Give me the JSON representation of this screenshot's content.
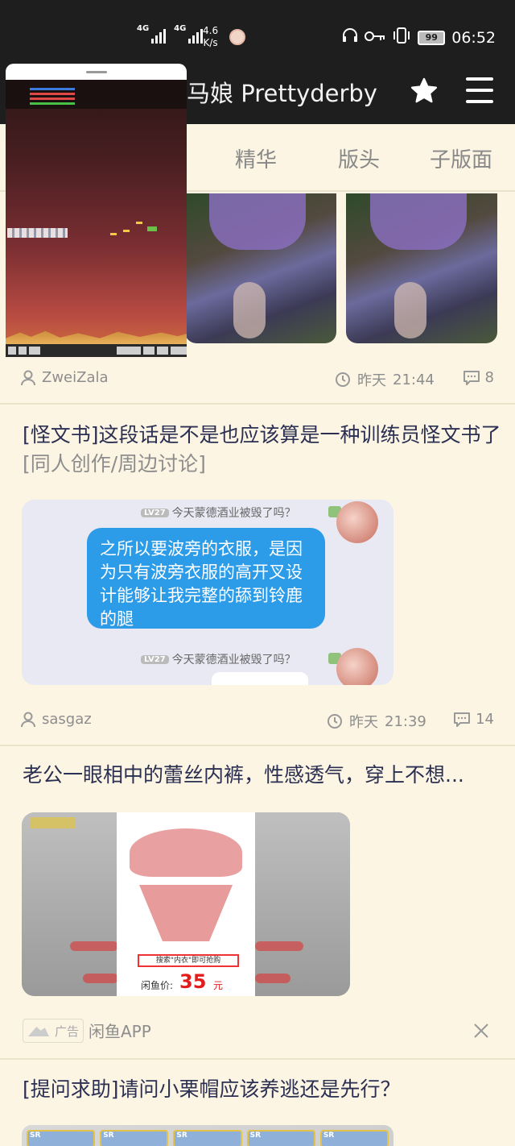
{
  "status_bar": {
    "network_1": "4G",
    "network_2": "4G",
    "speed_value": "4.6",
    "speed_unit": "K/s",
    "battery": "99",
    "time": "06:52"
  },
  "app_bar": {
    "title": "马娘 Prettyderby",
    "star_icon": "star-icon",
    "menu_icon": "menu-icon"
  },
  "tabs": [
    {
      "label": "精华"
    },
    {
      "label": "版头"
    },
    {
      "label": "子版面"
    }
  ],
  "posts": [
    {
      "author": "ZweiZala",
      "time_day": "昨天",
      "time_clock": "21:44",
      "comments": "8"
    },
    {
      "title": "[怪文书]这段话是不是也应该算是一种训练员怪文书了",
      "tag": "[同人创作/周边讨论]",
      "chat": {
        "level": "LV27",
        "name": "今天蒙德酒业被毁了吗？",
        "message": "之所以要波旁的衣服，是因为只有波旁衣服的高开叉设计能够让我完整的舔到铃鹿的腿"
      },
      "author": "sasgaz",
      "time_day": "昨天",
      "time_clock": "21:39",
      "comments": "14"
    },
    {
      "title": "老公一眼相中的蕾丝内裤，性感透气，穿上不想...",
      "ad_image": {
        "search_text": "搜索\"内衣\"即可抢购",
        "price_label": "闲鱼价:",
        "price": "35",
        "unit": "元"
      },
      "ad_label": "广告",
      "ad_source": "闲鱼APP"
    },
    {
      "title": "[提问求助]请问小栗帽应该养逃还是先行？",
      "card_badge": "SR"
    }
  ]
}
